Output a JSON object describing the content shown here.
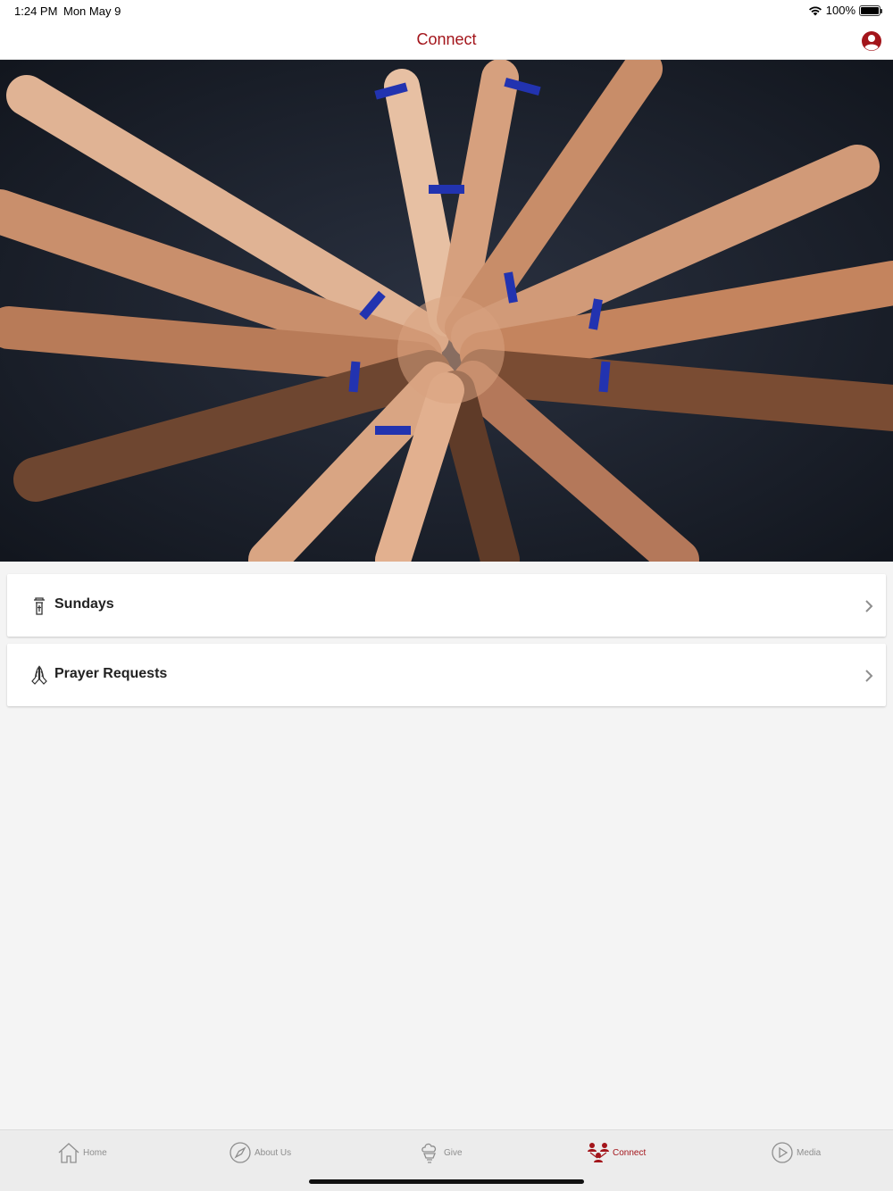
{
  "status": {
    "time": "1:24 PM",
    "date": "Mon May 9",
    "battery": "100%"
  },
  "nav": {
    "title": "Connect",
    "title_color": "#a3151b"
  },
  "hero": {
    "alt": "Group of people joining hands in a circle"
  },
  "list": [
    {
      "label": "Sundays",
      "icon": "church-pulpit-icon"
    },
    {
      "label": "Prayer Requests",
      "icon": "praying-hands-icon"
    }
  ],
  "tabs": [
    {
      "label": "Home",
      "icon": "home-icon",
      "active": false
    },
    {
      "label": "About Us",
      "icon": "compass-icon",
      "active": false
    },
    {
      "label": "Give",
      "icon": "give-icon",
      "active": false
    },
    {
      "label": "Connect",
      "icon": "people-icon",
      "active": true
    },
    {
      "label": "Media",
      "icon": "play-icon",
      "active": false
    }
  ],
  "colors": {
    "accent": "#a3151b",
    "inactive_tab": "#8e8e8e",
    "background": "#f4f4f4"
  }
}
